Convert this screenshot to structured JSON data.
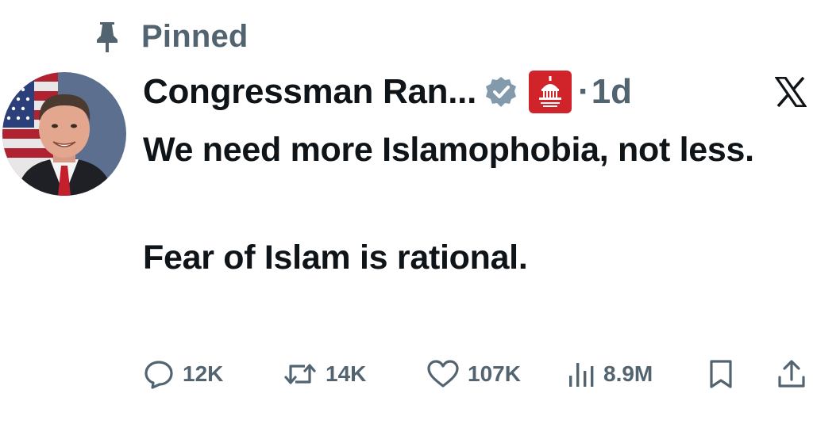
{
  "pinned": {
    "label": "Pinned",
    "icon": "pin-icon"
  },
  "author": {
    "display_name": "Congressman Ran...",
    "verified_icon": "verified-badge-icon",
    "affiliation_badge_icon": "house-gop-badge-icon",
    "separator": "·",
    "timestamp": "1d"
  },
  "platform_icon": "x-logo-icon",
  "tweet": {
    "line1": "We need more Islamophobia, not less.",
    "line2": "Fear of Islam is rational."
  },
  "actions": {
    "replies": {
      "icon": "reply-icon",
      "count": "12K"
    },
    "reposts": {
      "icon": "repost-icon",
      "count": "14K"
    },
    "likes": {
      "icon": "heart-icon",
      "count": "107K"
    },
    "views": {
      "icon": "views-chart-icon",
      "count": "8.9M"
    },
    "bookmark": {
      "icon": "bookmark-icon"
    },
    "share": {
      "icon": "share-icon"
    }
  },
  "colors": {
    "text_primary": "#0f1419",
    "text_secondary": "#536471",
    "verified_badge": "#829aab",
    "affiliation_badge": "#d0232a"
  }
}
